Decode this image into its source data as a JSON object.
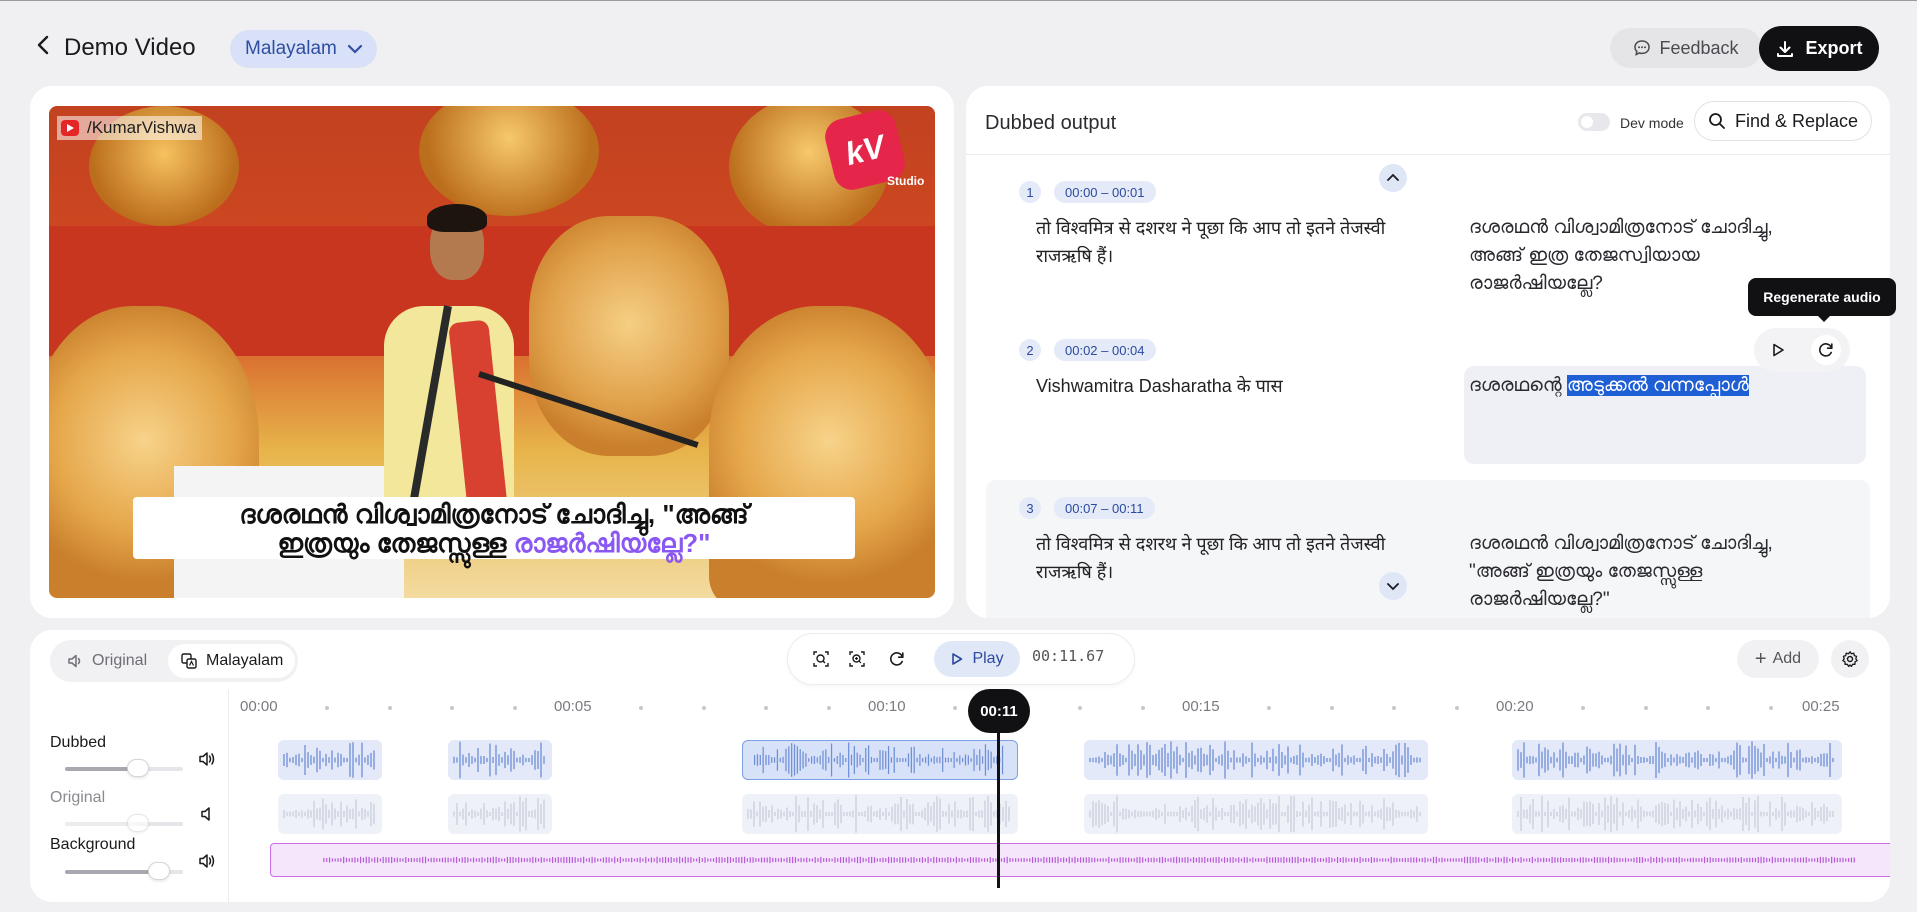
{
  "header": {
    "title": "Demo Video",
    "language": "Malayalam",
    "feedback_label": "Feedback",
    "export_label": "Export"
  },
  "video": {
    "channel_tag": "/KumarVishwa",
    "logo_text": "kV",
    "logo_sub": "Studio",
    "subtitle_line1": "ദശരഥൻ വിശ്വാമിത്രനോട് ചോദിച്ചു, \"അങ്ങ്",
    "subtitle_line2_plain": "ഇത്രയും തേജസ്സുള്ള ",
    "subtitle_line2_highlight": "രാജർഷിയല്ലേ?\""
  },
  "dubbed": {
    "title": "Dubbed output",
    "dev_mode_label": "Dev mode",
    "dev_mode_on": false,
    "find_replace_label": "Find & Replace",
    "tooltip": "Regenerate audio",
    "segments": [
      {
        "index": "1",
        "time": "00:00 – 00:01",
        "source": "तो विश्वमित्र से दशरथ ने पूछा कि आप तो इतने तेजस्वी राजऋषि हैं।",
        "target": "ദശരഥൻ വിശ്വാമിത്രനോട് ചോദിച്ചു, അങ്ങ് ഇത്ര തേജസ്വിയായ രാജർഷിയല്ലേ?"
      },
      {
        "index": "2",
        "time": "00:02 – 00:04",
        "source": "Vishwamitra Dasharatha के पास",
        "target_plain": "ദശരഥന്റെ ",
        "target_selected": "അടുക്കൽ വന്നപ്പോൾ"
      },
      {
        "index": "3",
        "time": "00:07 – 00:11",
        "source": "तो विश्वमित्र से दशरथ ने पूछा कि आप तो इतने तेजस्वी राजऋषि हैं।",
        "target": "ദശരഥൻ വിശ്വാമിത്രനോട് ചോദിച്ചു, \"അങ്ങ് ഇത്രയും തേജസ്സുള്ള രാജർഷിയല്ലേ?\""
      }
    ]
  },
  "timeline": {
    "mode_original": "Original",
    "mode_malayalam": "Malayalam",
    "active_mode": "Malayalam",
    "play_label": "Play",
    "time_readout": "00:11.67",
    "add_label": "Add",
    "playhead_label": "00:11",
    "ticks": [
      "00:00",
      "00:05",
      "00:10",
      "00:15",
      "00:20",
      "00:25"
    ],
    "tracks": [
      {
        "name": "Dubbed",
        "volume": 0.62,
        "muted": false
      },
      {
        "name": "Original",
        "volume": 0.62,
        "muted": true
      },
      {
        "name": "Background",
        "volume": 0.8,
        "muted": false
      }
    ]
  },
  "colors": {
    "accent": "#2c4aa0",
    "accent_bg": "#d8e1f7",
    "highlight_purple": "#8b57f3",
    "selection": "#1f5fd6",
    "background_track": "#c86fe6"
  }
}
